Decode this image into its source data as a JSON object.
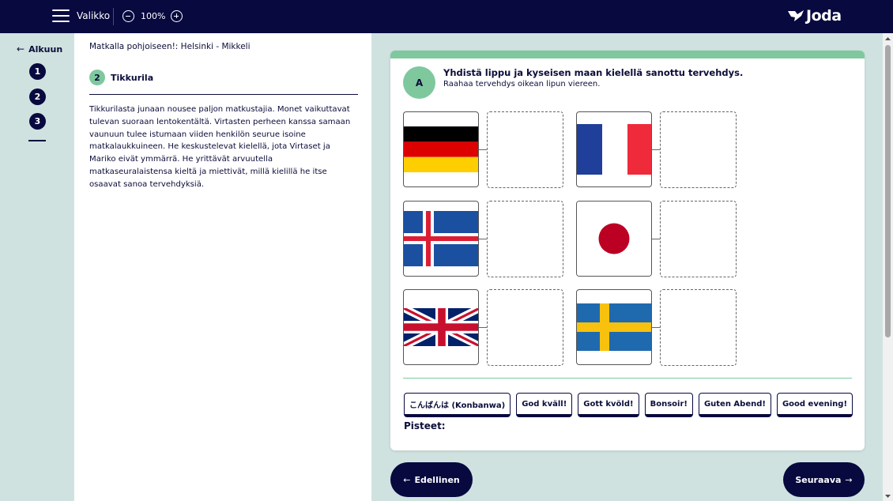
{
  "topbar": {
    "menu_label": "Valikko",
    "zoom_level": "100%",
    "logo_text": "Joda"
  },
  "leftnav": {
    "back_label": "Alkuun",
    "steps": [
      "1",
      "2",
      "3"
    ],
    "current_step": "2"
  },
  "text_panel": {
    "breadcrumb": "Matkalla pohjoiseen!: Helsinki - Mikkeli",
    "section_number": "2",
    "section_title": "Tikkurila",
    "body": "Tikkurilasta junaan nousee paljon matkustajia. Monet vaikuttavat tulevan suoraan lentokentältä. Virtasten perheen kanssa samaan vaunuun tulee istumaan viiden henkilön seurue isoine matkalaukkuineen. He keskustelevat kielellä, jota Virtaset ja Mariko eivät ymmärrä. He yrittävät arvuutella matkaseuralaistensa kieltä ja miettivät, millä kielillä he itse osaavat sanoa tervehdyksiä."
  },
  "exercise": {
    "badge": "A",
    "title": "Yhdistä lippu ja kyseisen maan kielellä sanottu tervehdys.",
    "instruction": "Raahaa tervehdys oikean lipun viereen.",
    "flags": [
      {
        "name": "germany-flag-icon"
      },
      {
        "name": "france-flag-icon"
      },
      {
        "name": "iceland-flag-icon"
      },
      {
        "name": "japan-flag-icon"
      },
      {
        "name": "uk-flag-icon"
      },
      {
        "name": "sweden-flag-icon"
      }
    ],
    "chips": [
      "こんばんは (Konbanwa)",
      "God kväll!",
      "Gott kvöld!",
      "Bonsoir!",
      "Guten Abend!",
      "Good evening!"
    ],
    "score_label": "Pisteet:"
  },
  "footer": {
    "prev_label": "Edellinen",
    "next_label": "Seuraava"
  },
  "colors": {
    "navy": "#07093f",
    "green": "#7fc89e",
    "bg": "#cfe2e0"
  }
}
